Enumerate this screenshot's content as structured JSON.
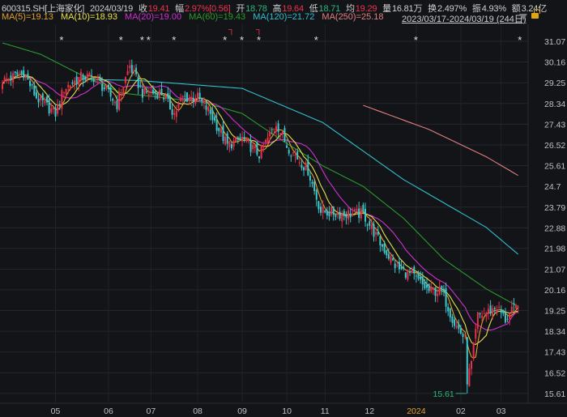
{
  "header": {
    "symbol": "600315.SH[上海家化]",
    "date": "2024/03/19",
    "close_label": "收",
    "close": "19.41",
    "change_label": "幅",
    "change": "2.97%[0.56]",
    "open_label": "开",
    "open": "18.78",
    "high_label": "高",
    "high": "19.64",
    "low_label": "低",
    "low": "18.71",
    "avg_label": "均",
    "avg": "19.29",
    "volume_label": "量",
    "volume": "16.81万",
    "turnover_label": "换",
    "turnover": "2.497%",
    "amplitude_label": "振",
    "amplitude": "4.93%",
    "amount_label": "额",
    "amount": "3.24亿"
  },
  "ma_legend": {
    "ma5": "MA(5)=19.13",
    "ma10": "MA(10)=18.93",
    "ma20": "MA(20)=19.00",
    "ma60": "MA(60)=19.43",
    "ma120": "MA(120)=21.72",
    "ma250": "MA(250)=25.18"
  },
  "range": "2023/03/17-2024/03/19 (244日)",
  "colors": {
    "up": "#e8304a",
    "down": "#3cc8cc",
    "ma5": "#e0a030",
    "ma10": "#e8e050",
    "ma20": "#d030d0",
    "ma60": "#2a9a2a",
    "ma120": "#30c0d0",
    "ma250": "#e08080"
  },
  "chart_data": {
    "type": "candlestick",
    "title": "600315.SH[上海家化]",
    "bars": 244,
    "ylim": [
      15.3,
      31.5
    ],
    "yticks": [
      "31.07",
      "30.16",
      "29.25",
      "28.34",
      "27.43",
      "26.52",
      "25.61",
      "24.7",
      "23.79",
      "22.88",
      "21.98",
      "21.07",
      "20.16",
      "19.25",
      "18.34",
      "17.43",
      "16.52",
      "15.61"
    ],
    "xticks": [
      {
        "label": "05",
        "bar": 25
      },
      {
        "label": "06",
        "bar": 50
      },
      {
        "label": "07",
        "bar": 70
      },
      {
        "label": "08",
        "bar": 92
      },
      {
        "label": "09",
        "bar": 113
      },
      {
        "label": "10",
        "bar": 134
      },
      {
        "label": "11",
        "bar": 152
      },
      {
        "label": "12",
        "bar": 173
      },
      {
        "label": "2024",
        "bar": 195,
        "highlight": true
      },
      {
        "label": "02",
        "bar": 216
      },
      {
        "label": "03",
        "bar": 235
      }
    ],
    "close_keypoints": [
      [
        0,
        29.33
      ],
      [
        10,
        29.7
      ],
      [
        16,
        28.6
      ],
      [
        25,
        27.9
      ],
      [
        29,
        29.0
      ],
      [
        37,
        29.5
      ],
      [
        43,
        29.5
      ],
      [
        48,
        29.0
      ],
      [
        54,
        28.3
      ],
      [
        60,
        30.0
      ],
      [
        66,
        28.8
      ],
      [
        75,
        28.8
      ],
      [
        81,
        27.9
      ],
      [
        85,
        28.6
      ],
      [
        92,
        28.6
      ],
      [
        98,
        27.9
      ],
      [
        106,
        26.5
      ],
      [
        113,
        26.8
      ],
      [
        121,
        26.1
      ],
      [
        129,
        27.5
      ],
      [
        134,
        26.5
      ],
      [
        144,
        25.4
      ],
      [
        150,
        23.6
      ],
      [
        159,
        23.5
      ],
      [
        170,
        23.5
      ],
      [
        178,
        22.2
      ],
      [
        186,
        21.1
      ],
      [
        193,
        20.8
      ],
      [
        201,
        20.1
      ],
      [
        207,
        20.1
      ],
      [
        213,
        18.7
      ],
      [
        218,
        18.0
      ],
      [
        219,
        16.2
      ],
      [
        221,
        16.9
      ],
      [
        224,
        19.0
      ],
      [
        229,
        19.2
      ],
      [
        233,
        19.4
      ],
      [
        237,
        18.85
      ],
      [
        241,
        19.3
      ],
      [
        243,
        19.41
      ]
    ],
    "low_marker": {
      "label": "15.61",
      "value": 15.61,
      "bar": 219
    },
    "ma60_keypoints": [
      [
        0,
        31.0
      ],
      [
        18,
        30.5
      ],
      [
        37,
        29.6
      ],
      [
        56,
        28.8
      ],
      [
        75,
        28.6
      ],
      [
        94,
        28.4
      ],
      [
        113,
        27.9
      ],
      [
        132,
        26.7
      ],
      [
        151,
        25.6
      ],
      [
        170,
        24.7
      ],
      [
        189,
        23.3
      ],
      [
        208,
        21.5
      ],
      [
        228,
        20.2
      ],
      [
        243,
        19.43
      ]
    ],
    "ma120_keypoints": [
      [
        39,
        29.4
      ],
      [
        64,
        29.35
      ],
      [
        113,
        29.0
      ],
      [
        151,
        27.5
      ],
      [
        189,
        25.0
      ],
      [
        228,
        22.9
      ],
      [
        243,
        21.72
      ]
    ],
    "ma250_keypoints": [
      [
        170,
        28.26
      ],
      [
        201,
        27.2
      ],
      [
        228,
        26.0
      ],
      [
        243,
        25.18
      ]
    ],
    "event_markers": [
      {
        "glyph": "*",
        "bar": 28
      },
      {
        "glyph": "*",
        "bar": 56
      },
      {
        "glyph": "*",
        "bar": 66
      },
      {
        "glyph": "*",
        "bar": 69
      },
      {
        "glyph": "*",
        "bar": 81
      },
      {
        "glyph": "*",
        "bar": 105
      },
      {
        "glyph": "*",
        "bar": 113
      },
      {
        "glyph": "*",
        "bar": 121
      },
      {
        "glyph": "*",
        "bar": 148
      },
      {
        "glyph": "*",
        "bar": 195
      },
      {
        "glyph": "*",
        "bar": 244
      }
    ],
    "flag_markers": [
      {
        "glyph": "┐",
        "bar": 108
      },
      {
        "glyph": "┐",
        "bar": 121
      }
    ]
  }
}
